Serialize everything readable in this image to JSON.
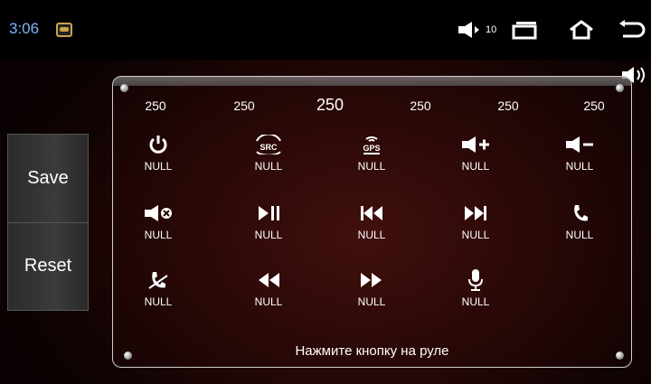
{
  "status_bar": {
    "time": "3:06",
    "volume_level": "10",
    "icons": [
      "app-icon",
      "volume-icon",
      "recent-apps-icon",
      "home-icon",
      "back-icon"
    ]
  },
  "sidebar": {
    "save_label": "Save",
    "reset_label": "Reset"
  },
  "steering": {
    "values": [
      "250",
      "250",
      "250",
      "250",
      "250",
      "250"
    ],
    "keys": [
      {
        "icon": "power-icon",
        "label": "NULL"
      },
      {
        "icon": "src-icon",
        "label": "NULL",
        "icon_text": "SRC"
      },
      {
        "icon": "gps-icon",
        "label": "NULL",
        "icon_text": "GPS"
      },
      {
        "icon": "volume-up-icon",
        "label": "NULL"
      },
      {
        "icon": "volume-down-icon",
        "label": "NULL"
      },
      {
        "icon": "mute-icon",
        "label": "NULL"
      },
      {
        "icon": "play-pause-icon",
        "label": "NULL"
      },
      {
        "icon": "previous-track-icon",
        "label": "NULL"
      },
      {
        "icon": "next-track-icon",
        "label": "NULL"
      },
      {
        "icon": "phone-answer-icon",
        "label": "NULL"
      },
      {
        "icon": "phone-hangup-icon",
        "label": "NULL"
      },
      {
        "icon": "rewind-icon",
        "label": "NULL"
      },
      {
        "icon": "fast-forward-icon",
        "label": "NULL"
      },
      {
        "icon": "microphone-icon",
        "label": "NULL"
      }
    ],
    "hint": "Нажмите кнопку на руле"
  },
  "colors": {
    "clock": "#7fb2ff",
    "background": "#2a0907"
  }
}
